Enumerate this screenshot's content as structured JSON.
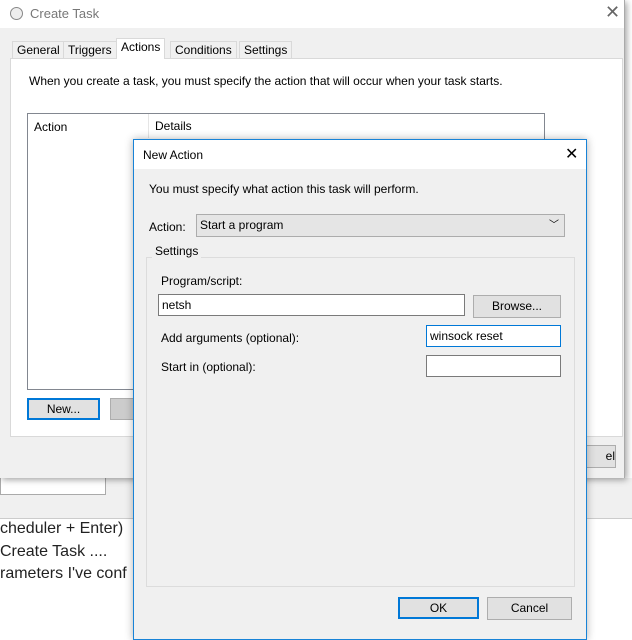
{
  "background": {
    "lines": [
      "cheduler + Enter)",
      "Create Task ....",
      "rameters I've conf"
    ]
  },
  "create_task": {
    "title": "Create Task",
    "tabs": [
      "General",
      "Triggers",
      "Actions",
      "Conditions",
      "Settings"
    ],
    "active_tab": "Actions",
    "description": "When you create a task, you must specify the action that will occur when your task starts.",
    "columns": [
      "Action",
      "Details"
    ],
    "new_button": "New...",
    "cancel_partial": "el"
  },
  "new_action": {
    "title": "New Action",
    "description": "You must specify what action this task will perform.",
    "action_label": "Action:",
    "action_value": "Start a program",
    "settings_label": "Settings",
    "program_label": "Program/script:",
    "program_value": "netsh",
    "browse": "Browse...",
    "args_label": "Add arguments (optional):",
    "args_value": "winsock reset",
    "start_label": "Start in (optional):",
    "start_value": "",
    "ok": "OK",
    "cancel": "Cancel"
  }
}
